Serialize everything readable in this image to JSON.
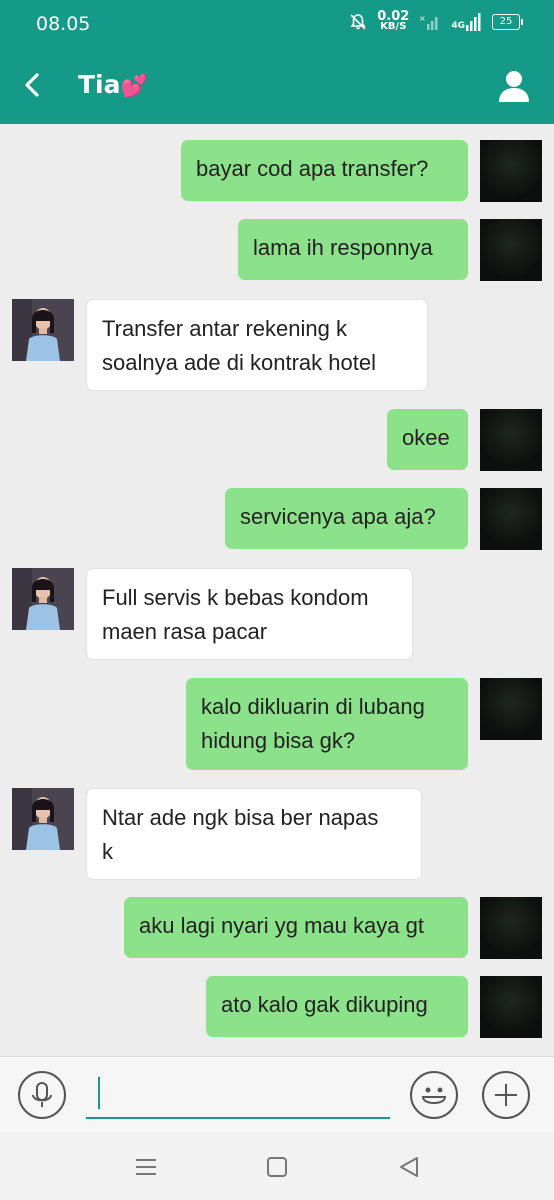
{
  "status_bar": {
    "time": "08.05",
    "net_speed_value": "0.02",
    "net_speed_unit": "KB/S",
    "network": "4G",
    "battery": "25"
  },
  "header": {
    "title": "Tia",
    "title_emoji": "💕"
  },
  "messages": [
    {
      "sender": "me",
      "text": "bayar cod apa transfer?"
    },
    {
      "sender": "me",
      "text": "lama ih responnya"
    },
    {
      "sender": "other",
      "lines": [
        "Transfer antar rekening k",
        "soalnya ade di kontrak hotel"
      ]
    },
    {
      "sender": "me",
      "text": "okee"
    },
    {
      "sender": "me",
      "text": "servicenya apa aja?"
    },
    {
      "sender": "other",
      "lines": [
        "Full servis k bebas kondom",
        "maen rasa pacar"
      ]
    },
    {
      "sender": "me",
      "lines": [
        "kalo dikluarin di lubang",
        "hidung bisa gk?"
      ]
    },
    {
      "sender": "other",
      "lines": [
        "Ntar ade ngk bisa ber napas",
        "k"
      ]
    },
    {
      "sender": "me",
      "text": "aku lagi nyari yg mau kaya gt"
    },
    {
      "sender": "me",
      "text": "ato kalo gak dikuping"
    }
  ],
  "input": {
    "value": ""
  },
  "colors": {
    "header": "#159a87",
    "outgoing_bubble": "#8ce28a",
    "incoming_bubble": "#ffffff",
    "chat_background": "#ededed"
  }
}
